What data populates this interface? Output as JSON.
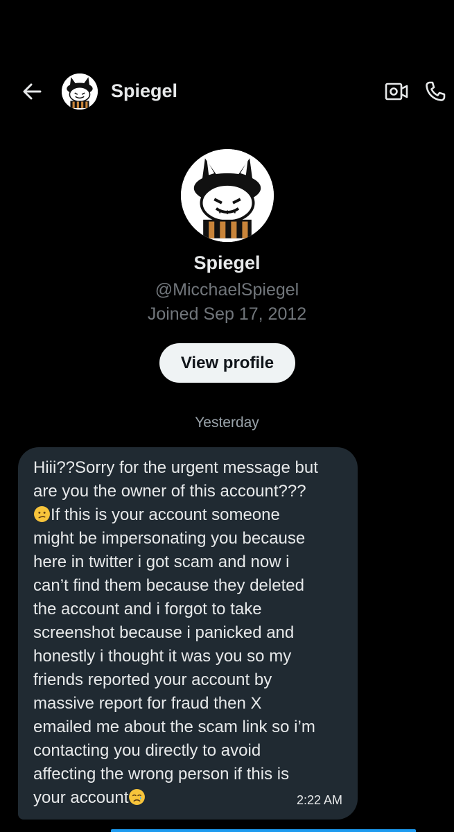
{
  "header": {
    "name": "Spiegel",
    "icons": {
      "back": "arrow-left-icon",
      "video": "video-camera-icon",
      "call": "phone-icon"
    }
  },
  "profile": {
    "name": "Spiegel",
    "handle": "@MicchaelSpiegel",
    "joined": "Joined Sep 17, 2012",
    "view_profile_label": "View profile"
  },
  "conversation": {
    "day_divider": "Yesterday",
    "messages": [
      {
        "lines": [
          "Hiii??Sorry for the urgent message but",
          "are you the owner of this account???",
          "If this is your account someone",
          "might be impersonating you because",
          "here in twitter i got scam and now i",
          "can’t find them because they deleted",
          "the account and i forgot to take",
          "screenshot because i panicked and",
          "honestly i thought it was you so my",
          "friends reported your account by",
          "massive report for fraud then X",
          "emailed me about the scam link so i’m",
          "contacting you directly to avoid",
          "affecting the wrong person if this is",
          "your account"
        ],
        "emojis": [
          "confused-face-emoji",
          "crying-face-emoji"
        ],
        "time": "2:22 AM"
      }
    ]
  },
  "colors": {
    "background": "#000000",
    "primary_text": "#e7e9ea",
    "secondary_text": "#71767b",
    "bubble": "#202a32",
    "button_bg": "#eff3f4",
    "accent": "#1d9bf0"
  }
}
